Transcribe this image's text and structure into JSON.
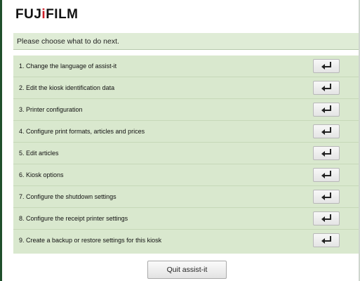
{
  "brand": {
    "logo_prefix": "FUJ",
    "logo_bang": "i",
    "logo_suffix": "FILM"
  },
  "prompt": "Please choose what to do next.",
  "menu": {
    "items": [
      {
        "label": "1. Change the language of assist-it",
        "icon": "enter-return-icon"
      },
      {
        "label": "2. Edit the kiosk identification data",
        "icon": "enter-return-icon"
      },
      {
        "label": "3. Printer configuration",
        "icon": "enter-return-icon"
      },
      {
        "label": "4. Configure print formats, articles and prices",
        "icon": "enter-return-icon"
      },
      {
        "label": "5. Edit articles",
        "icon": "enter-return-icon"
      },
      {
        "label": "6. Kiosk options",
        "icon": "enter-return-icon"
      },
      {
        "label": "7. Configure the shutdown settings",
        "icon": "enter-return-icon"
      },
      {
        "label": "8. Configure the receipt printer settings",
        "icon": "enter-return-icon"
      },
      {
        "label": "9. Create a backup or restore settings for this kiosk",
        "icon": "enter-return-icon"
      }
    ]
  },
  "footer": {
    "quit_label": "Quit assist-it"
  },
  "colors": {
    "panel_bg": "#d9e8ce",
    "prompt_bg": "#dfecd6",
    "frame_accent": "#1f4f2b",
    "logo_accent": "#d0202a"
  }
}
